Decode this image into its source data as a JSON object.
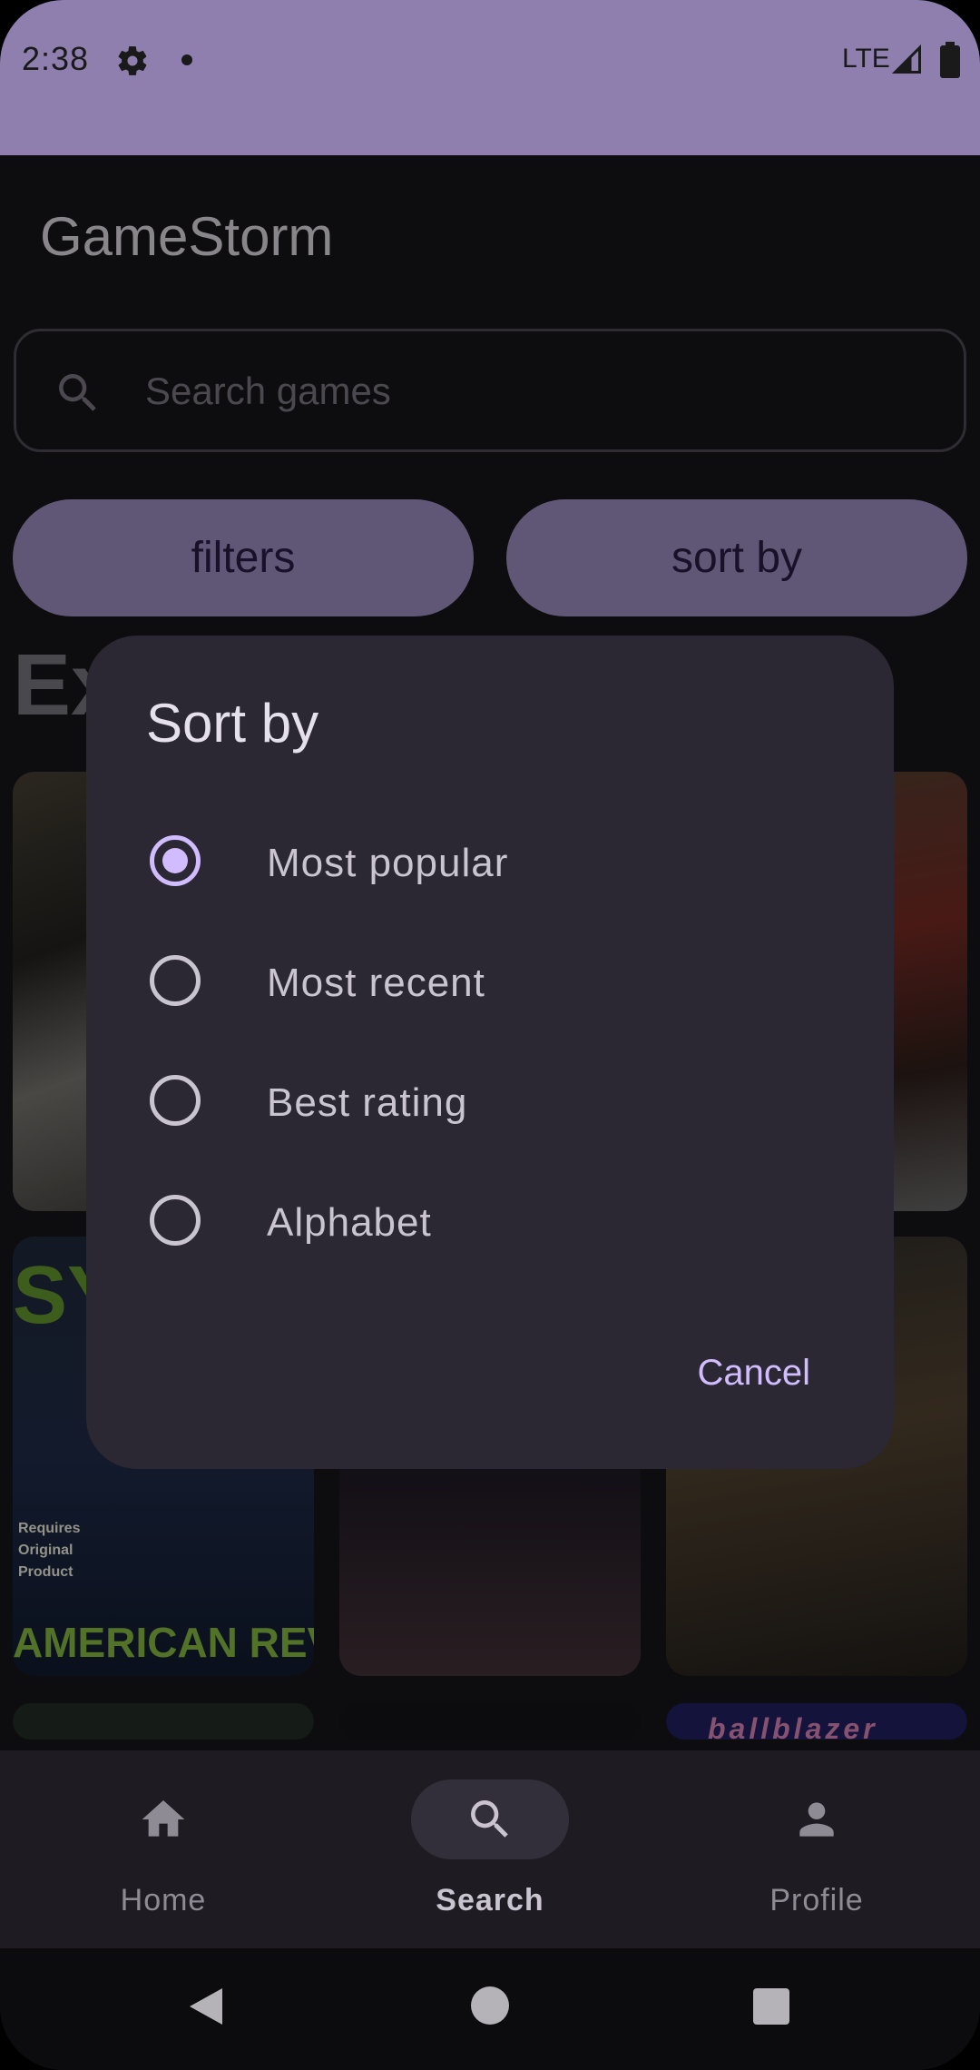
{
  "status_bar": {
    "time": "2:38",
    "network": "LTE",
    "icons": [
      "gear-icon",
      "notification-dot",
      "signal-icon",
      "battery-icon"
    ]
  },
  "app": {
    "title": "GameStorm",
    "section_title": "Ex"
  },
  "search": {
    "placeholder": "Search games"
  },
  "buttons": {
    "filters": "filters",
    "sort_by": "sort by"
  },
  "cards": {
    "c4_top": "SY",
    "c4_requires": "Requires\nOriginal\nProduct",
    "c4_bottom": "AMERICAN REVOLT",
    "c9_text": "ballblazer"
  },
  "dialog": {
    "title": "Sort by",
    "options": [
      {
        "label": "Most popular",
        "selected": true
      },
      {
        "label": "Most recent",
        "selected": false
      },
      {
        "label": "Best rating",
        "selected": false
      },
      {
        "label": "Alphabet",
        "selected": false
      }
    ],
    "cancel": "Cancel"
  },
  "bottom_nav": {
    "items": [
      {
        "label": "Home",
        "icon": "home-icon",
        "active": false
      },
      {
        "label": "Search",
        "icon": "search-icon",
        "active": true
      },
      {
        "label": "Profile",
        "icon": "person-icon",
        "active": false
      }
    ]
  },
  "colors": {
    "accent": "#8e7fae",
    "primary_light": "#d0bcff",
    "dialog_bg": "#2b2833",
    "background": "#141316"
  }
}
